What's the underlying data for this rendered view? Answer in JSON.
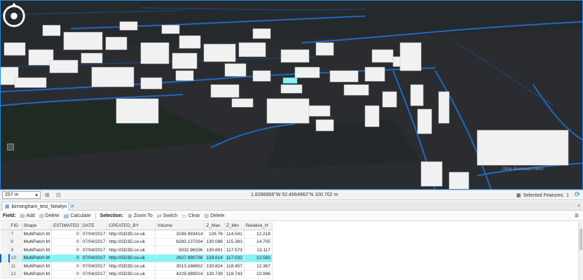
{
  "scene": {
    "street_label": "Olton Boulevard West"
  },
  "status": {
    "scale": "257 m",
    "coordinates": "1.8286868°W 52.4664962°N  100.702 m",
    "selected_label": "Selected Features:",
    "selected_count": "1"
  },
  "tab": {
    "label": "birmingham_test_Newlyn"
  },
  "toolbar": {
    "field_label": "Field:",
    "add": "Add",
    "delete": "Delete",
    "calculate": "Calculate",
    "selection_label": "Selection:",
    "zoom_to": "Zoom To",
    "switch": "Switch",
    "clear": "Clear",
    "delete2": "Delete"
  },
  "table": {
    "columns": [
      "FID",
      "Shape",
      "ESTIMATED",
      "DATE",
      "CREATED_BY",
      "Volume",
      "Z_Max",
      "Z_Min",
      "Relative_H"
    ],
    "rows": [
      [
        "7",
        "MultiPatch M",
        "0",
        "07/04/2017",
        "http://GD3D.co.uk",
        "3194.993414",
        "126.76",
        "114.541",
        "12.218"
      ],
      [
        "8",
        "MultiPatch M",
        "0",
        "07/04/2017",
        "http://GD3D.co.uk",
        "6293.137034",
        "130.088",
        "115.383",
        "14.705"
      ],
      [
        "9",
        "MultiPatch M",
        "0",
        "07/04/2017",
        "http://GD3D.co.uk",
        "5032.96336",
        "130.691",
        "117.573",
        "13.117"
      ],
      [
        "10",
        "MultiPatch M",
        "0",
        "07/04/2017",
        "http://GD3D.co.uk",
        "2627.990736",
        "129.614",
        "117.032",
        "12.582"
      ],
      [
        "11",
        "MultiPatch M",
        "0",
        "07/04/2017",
        "http://GD3D.co.uk",
        "3013.168652",
        "130.824",
        "118.457",
        "12.367"
      ],
      [
        "12",
        "MultiPatch M",
        "0",
        "07/04/2017",
        "http://GD3D.co.uk",
        "4229.089014",
        "130.739",
        "119.743",
        "10.996"
      ]
    ],
    "selected_row_index": 3
  },
  "colors": {
    "selection": "#86f3f6",
    "road": "#1f6fd1",
    "background": "#2a2c2f"
  }
}
